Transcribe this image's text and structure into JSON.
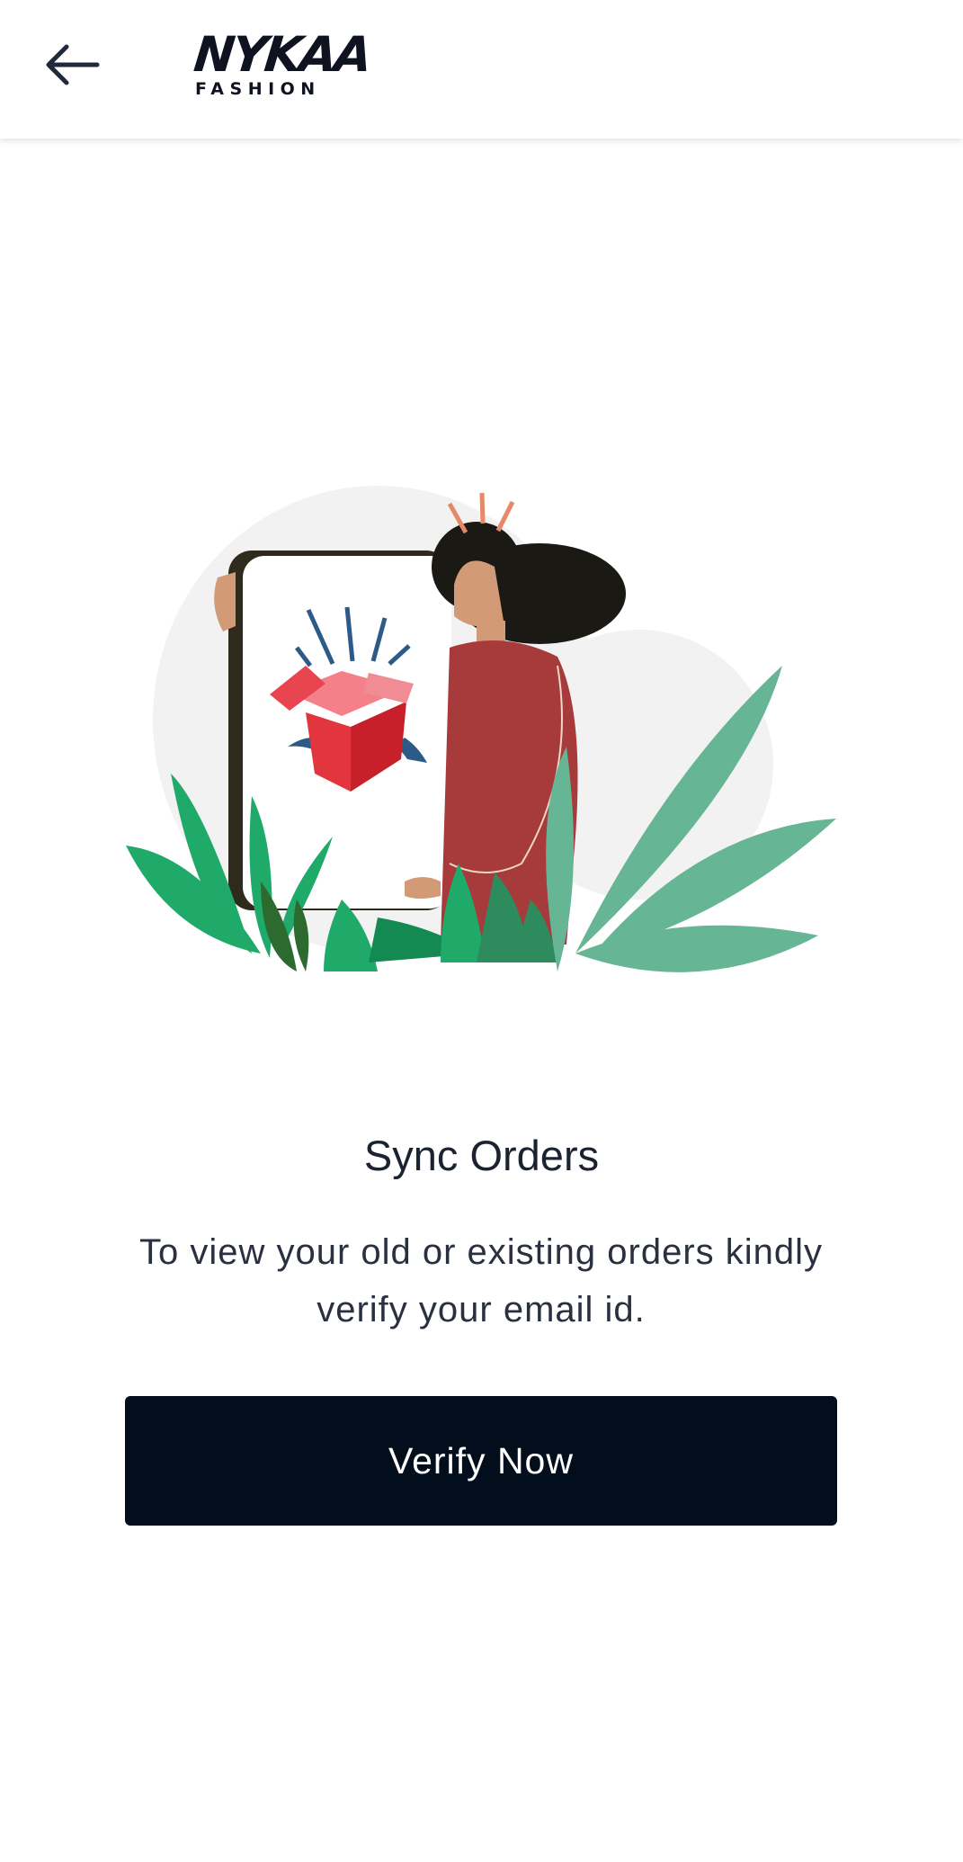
{
  "header": {
    "back_icon": "arrow-left-icon",
    "logo": {
      "brand": "NYKAA",
      "sub": "FASHION"
    }
  },
  "main": {
    "title": "Sync Orders",
    "description": "To view your old or existing orders kindly verify your email id.",
    "verify_button_label": "Verify Now"
  },
  "colors": {
    "primary_button": "#020e1c",
    "text_dark": "#1b2230",
    "plant_green": "#1faa6a",
    "plant_light": "#66b594",
    "dress_red": "#a73a3a",
    "box_red": "#e33f43"
  }
}
